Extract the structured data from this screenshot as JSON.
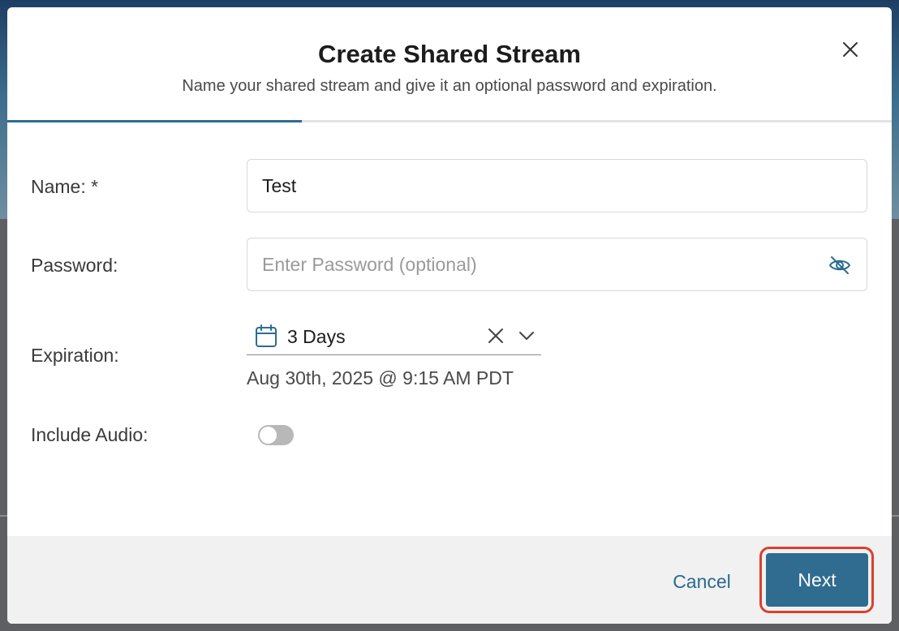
{
  "dialog": {
    "title": "Create Shared Stream",
    "subtitle": "Name your shared stream and give it an optional password and expiration.",
    "step_progress": 0.333
  },
  "form": {
    "name": {
      "label": "Name: *",
      "value": "Test"
    },
    "password": {
      "label": "Password:",
      "value": "",
      "placeholder": "Enter Password (optional)"
    },
    "expiration": {
      "label": "Expiration:",
      "selected": "3 Days",
      "date_text": "Aug 30th, 2025 @ 9:15 AM PDT"
    },
    "include_audio": {
      "label": "Include Audio:",
      "enabled": false
    }
  },
  "footer": {
    "cancel_label": "Cancel",
    "next_label": "Next"
  },
  "colors": {
    "accent": "#2f6c8f",
    "highlight": "#d9412e"
  },
  "icons": {
    "close": "close-icon",
    "password_visibility": "eye-off-icon",
    "calendar": "calendar-icon",
    "clear": "clear-icon",
    "dropdown": "chevron-down-icon"
  }
}
